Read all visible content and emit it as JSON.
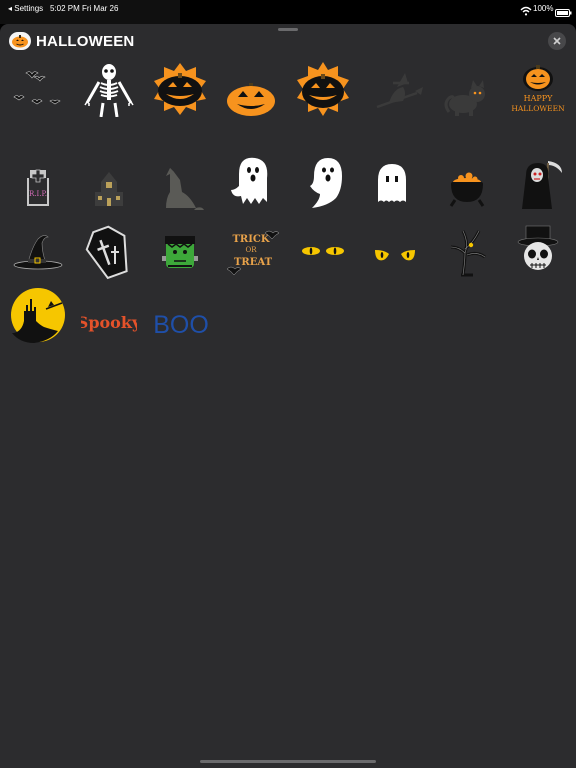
{
  "status_bar": {
    "back_label": "◂ Settings",
    "time": "5:02 PM",
    "date": "Fri Mar 26",
    "battery": "100%"
  },
  "pack": {
    "title": "HALLOWEEN"
  },
  "stickers": {
    "happy_halloween_text": [
      "HAPPY",
      "HALLOWEEN"
    ],
    "rip_text": "R.I.P.",
    "trick_text": [
      "TRICK",
      "OR",
      "TREAT"
    ],
    "spooky_text": "Spooky",
    "boo_text": "BOO"
  },
  "colors": {
    "sheet_background": "#2c2c2e",
    "pumpkin_orange": "#f7931e",
    "boo_blue": "#1f4fa8",
    "spooky_red": "#e4522a",
    "moon_yellow": "#f6c600"
  }
}
